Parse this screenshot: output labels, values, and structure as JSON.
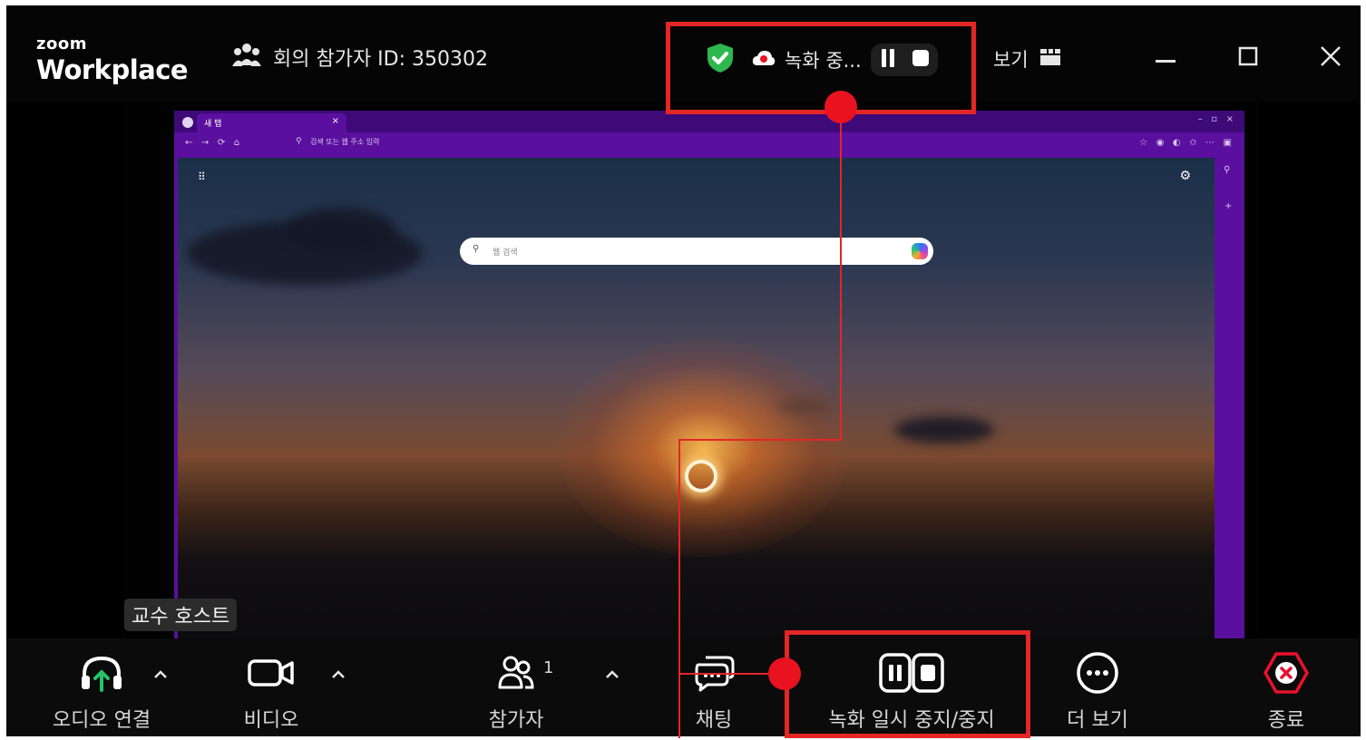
{
  "app": {
    "logo_small": "zoom",
    "logo_big": "Workplace",
    "meeting_label": "회의 참가자 ID: 350302",
    "recording_status": "녹화 중...",
    "view_label": "보기",
    "host_label": "교수 호스트"
  },
  "shared_screen": {
    "browser_tab_label": "새 탭",
    "address_text": "검색 또는 웹 주소 입력",
    "search_placeholder": "웹 검색"
  },
  "toolbar": {
    "audio_label": "오디오 연결",
    "video_label": "비디오",
    "participants_label": "참가자",
    "participants_count": "1",
    "chat_label": "채팅",
    "record_label": "녹화 일시 중지/중지",
    "more_label": "더 보기",
    "end_label": "종료"
  },
  "colors": {
    "annotation_red": "#e32626",
    "shield_green": "#2db84d",
    "end_red": "#e8112d",
    "audio_green": "#27c46a",
    "browser_purple": "#5a0f9e"
  },
  "icons": [
    "shield-check-icon",
    "cloud-record-icon",
    "pause-icon",
    "stop-icon",
    "participants-icon",
    "view-grid-icon",
    "minimize-icon",
    "maximize-icon",
    "close-icon",
    "headphones-icon",
    "video-icon",
    "chat-icon",
    "more-icon",
    "end-icon",
    "chevron-up-icon"
  ]
}
